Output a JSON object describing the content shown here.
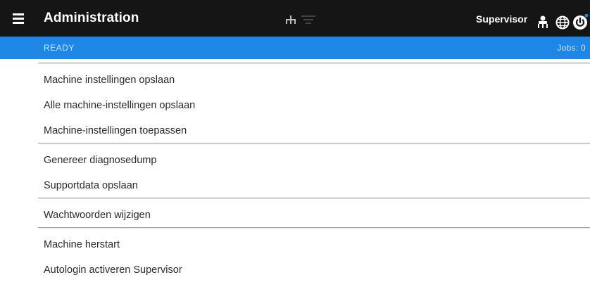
{
  "header": {
    "title": "Administration",
    "user": "Supervisor",
    "icons": {
      "menu": "hamburger-menu-icon",
      "network": "network-icon",
      "queue": "queue-filter-icon",
      "user": "user-icon",
      "language": "globe-icon",
      "power": "power-icon"
    }
  },
  "status": {
    "state": "READY",
    "jobs": "Jobs: 0"
  },
  "menu": {
    "items": [
      "Machine instellingen opslaan",
      "Alle machine-instellingen opslaan",
      "Machine-instellingen toepassen",
      "Genereer diagnosedump",
      "Supportdata opslaan",
      "Wachtwoorden wijzigen",
      "Machine herstart",
      "Autologin activeren Supervisor"
    ]
  },
  "colors": {
    "topbar": "#151515",
    "statusbar": "#1e87e6",
    "status_text": "#cfe5fb",
    "item_text": "#2a2a2a",
    "divider": "#a8a8a8"
  }
}
